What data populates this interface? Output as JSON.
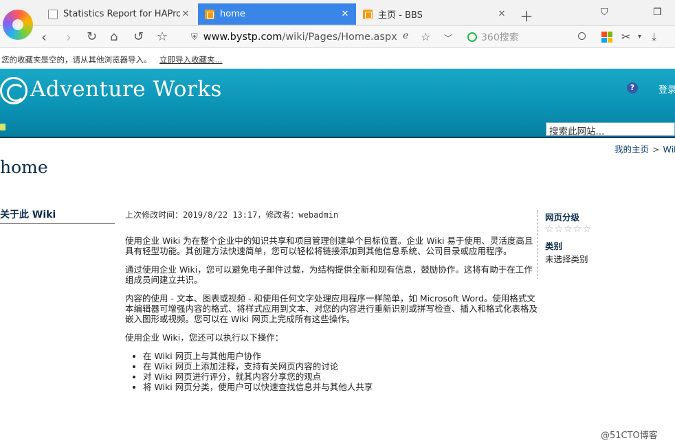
{
  "browser": {
    "tabs": [
      {
        "label": "Statistics Report for HAProxy",
        "active": false,
        "icon": "document-icon"
      },
      {
        "label": "home",
        "active": true,
        "icon": "sharepoint-icon"
      },
      {
        "label": "主页 - BBS",
        "active": false,
        "icon": "sharepoint-icon"
      }
    ],
    "url_domain": "www.bystp.com",
    "url_path": "/wiki/Pages/Home.aspx",
    "search_placeholder": "360搜索",
    "favorites_text": "您的收藏夹是空的，请从其他浏览器导入。",
    "favorites_link": "立即导入收藏夹..."
  },
  "site": {
    "title": "Adventure Works",
    "signin": "登录",
    "search_placeholder": "搜索此网站..."
  },
  "breadcrumb": {
    "home": "我的主页",
    "sep": ">",
    "current": "Wiki"
  },
  "page": {
    "title": "home",
    "leftnav_title": "关于此 Wiki",
    "modified_label": "上次修改时间：",
    "modified_value": "2019/8/22 13:17",
    "modified_by_label": "，修改者：",
    "modified_by_value": "webadmin",
    "paragraphs": [
      "使用企业 Wiki 为在整个企业中的知识共享和项目管理创建单个目标位置。企业 Wiki 易于使用、灵活度高且具有轻型功能。其创建方法快速简单，您可以轻松将链接添加到其他信息系统、公司目录或应用程序。",
      "通过使用企业 Wiki，您可以避免电子邮件过载，为结构提供全新和现有信息，鼓励协作。这将有助于在工作组成员间建立共识。",
      "内容的使用 - 文本、图表或视频 - 和使用任何文字处理应用程序一样简单，如 Microsoft Word。使用格式文本编辑器可增强内容的格式、将样式应用到文本、对您的内容进行重新识别或拼写检查、插入和格式化表格及嵌入图形或视频。您可以在 Wiki 网页上完成所有这些操作。",
      "使用企业 Wiki，您还可以执行以下操作："
    ],
    "list": [
      "在 Wiki 网页上与其他用户协作",
      "在 Wiki 网页上添加注释，支持有关网页内容的讨论",
      "对 Wiki 网页进行评分，就其内容分享您的观点",
      "将 Wiki 网页分类，使用户可以快速查找信息并与其他人共享"
    ]
  },
  "rightpanel": {
    "rating_title": "网页分级",
    "rating_stars": "☆☆☆☆☆",
    "rating_value": 0,
    "category_title": "类别",
    "category_value": "未选择类别"
  },
  "watermark": "@51CTO博客",
  "colors": {
    "header": "#0b93b5",
    "active_tab": "#3a86e8",
    "title": "#0b2b4a"
  }
}
